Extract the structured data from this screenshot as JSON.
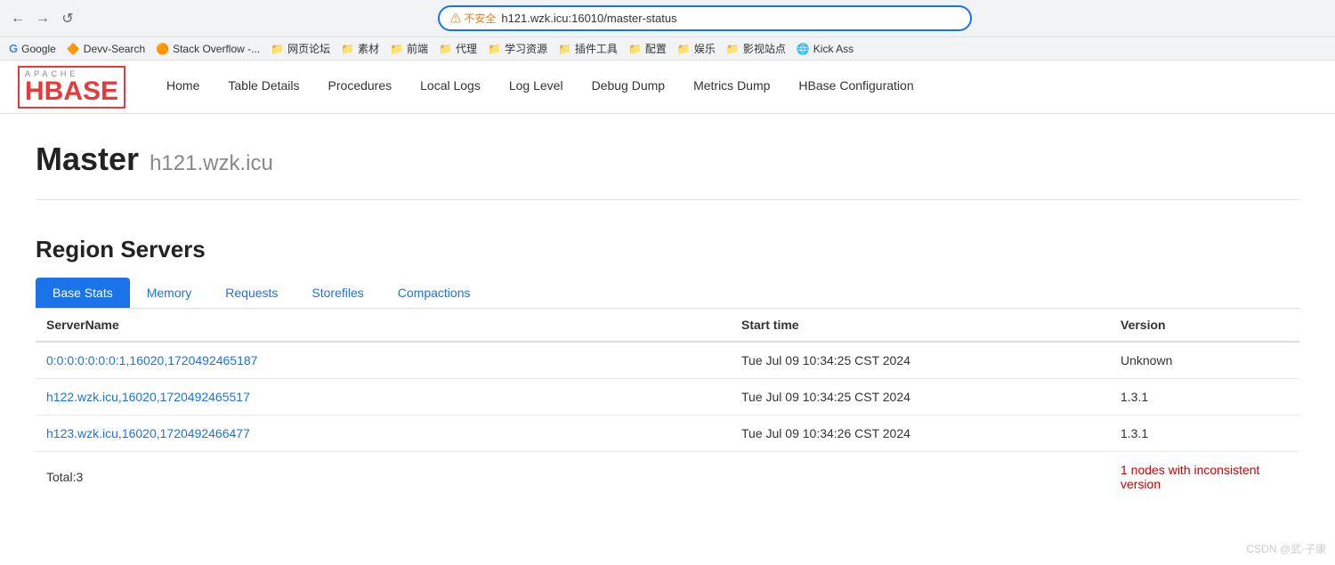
{
  "browser": {
    "back_label": "←",
    "forward_label": "→",
    "reload_label": "↺",
    "warning_text": "⚠ 不安全",
    "url": "h121.wzk.icu:16010/master-status",
    "bookmarks": [
      {
        "icon": "G",
        "label": "Google"
      },
      {
        "icon": "D",
        "label": "Devv-Search"
      },
      {
        "icon": "S",
        "label": "Stack Overflow -..."
      },
      {
        "icon": "📄",
        "label": "网页论坛"
      },
      {
        "icon": "📄",
        "label": "素材"
      },
      {
        "icon": "📄",
        "label": "前端"
      },
      {
        "icon": "📄",
        "label": "代理"
      },
      {
        "icon": "📄",
        "label": "学习资源"
      },
      {
        "icon": "📄",
        "label": "插件工具"
      },
      {
        "icon": "📄",
        "label": "配置"
      },
      {
        "icon": "📄",
        "label": "娱乐"
      },
      {
        "icon": "📄",
        "label": "影视站点"
      },
      {
        "icon": "K",
        "label": "Kick Ass"
      }
    ]
  },
  "hbase": {
    "logo_apache": "APACHE",
    "logo_hbase": "HBASE",
    "nav_items": [
      {
        "label": "Home",
        "active": true
      },
      {
        "label": "Table Details"
      },
      {
        "label": "Procedures"
      },
      {
        "label": "Local Logs"
      },
      {
        "label": "Log Level"
      },
      {
        "label": "Debug Dump"
      },
      {
        "label": "Metrics Dump"
      },
      {
        "label": "HBase Configuration"
      }
    ]
  },
  "page": {
    "title": "Master",
    "subtitle": "h121.wzk.icu",
    "section_title": "Region Servers",
    "tabs": [
      {
        "label": "Base Stats",
        "active": true
      },
      {
        "label": "Memory"
      },
      {
        "label": "Requests"
      },
      {
        "label": "Storefiles"
      },
      {
        "label": "Compactions"
      }
    ],
    "table": {
      "columns": [
        {
          "label": "ServerName",
          "key": "server"
        },
        {
          "label": "Start time",
          "key": "start_time"
        },
        {
          "label": "Version",
          "key": "version"
        }
      ],
      "rows": [
        {
          "server": "0:0:0:0:0:0:0:1,16020,1720492465187",
          "server_href": "#",
          "start_time": "Tue Jul 09 10:34:25 CST 2024",
          "version": "Unknown"
        },
        {
          "server": "h122.wzk.icu,16020,1720492465517",
          "server_href": "#",
          "start_time": "Tue Jul 09 10:34:25 CST 2024",
          "version": "1.3.1"
        },
        {
          "server": "h123.wzk.icu,16020,1720492466477",
          "server_href": "#",
          "start_time": "Tue Jul 09 10:34:26 CST 2024",
          "version": "1.3.1"
        }
      ],
      "total_label": "Total:3",
      "inconsistent_text": "1 nodes with inconsistent version"
    }
  },
  "watermark": "CSDN @武·子康"
}
